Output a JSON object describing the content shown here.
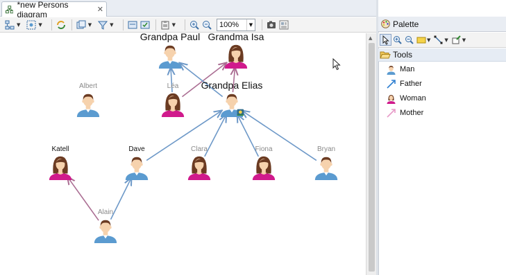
{
  "editor": {
    "tab_title": "*new Persons diagram",
    "zoom": "100%"
  },
  "colors": {
    "man": "#5b9bd0",
    "woman_hair": "#6b3b22",
    "woman_body": "#d01a8c",
    "skin": "#f6d2ad",
    "father_edge": "#6e99c8",
    "mother_edge": "#ab6e93"
  },
  "nodes": [
    {
      "key": "grandpa_paul",
      "name": "Grandpa Paul",
      "gender": "man"
    },
    {
      "key": "grandma_isa",
      "name": "Grandma Isa",
      "gender": "woman"
    },
    {
      "key": "albert",
      "name": "Albert",
      "gender": "man"
    },
    {
      "key": "lea",
      "name": "Léa",
      "gender": "woman"
    },
    {
      "key": "grandpa_elias",
      "name": "Grandpa Elias",
      "gender": "man"
    },
    {
      "key": "katell",
      "name": "Katell",
      "gender": "woman"
    },
    {
      "key": "dave",
      "name": "Dave",
      "gender": "man"
    },
    {
      "key": "clara",
      "name": "Clara",
      "gender": "woman"
    },
    {
      "key": "fiona",
      "name": "Fiona",
      "gender": "woman"
    },
    {
      "key": "bryan",
      "name": "Bryan",
      "gender": "man"
    },
    {
      "key": "alain",
      "name": "Alain",
      "gender": "man"
    }
  ],
  "edges": [
    {
      "from": "lea",
      "to": "grandpa_paul",
      "type": "father"
    },
    {
      "from": "lea",
      "to": "grandma_isa",
      "type": "mother"
    },
    {
      "from": "grandpa_elias",
      "to": "grandpa_paul",
      "type": "father"
    },
    {
      "from": "grandpa_elias",
      "to": "grandma_isa",
      "type": "mother"
    },
    {
      "from": "dave",
      "to": "grandpa_elias",
      "type": "father"
    },
    {
      "from": "clara",
      "to": "grandpa_elias",
      "type": "father"
    },
    {
      "from": "fiona",
      "to": "grandpa_elias",
      "type": "father"
    },
    {
      "from": "bryan",
      "to": "grandpa_elias",
      "type": "father"
    },
    {
      "from": "alain",
      "to": "katell",
      "type": "mother"
    },
    {
      "from": "alain",
      "to": "dave",
      "type": "father"
    }
  ],
  "palette": {
    "title": "Palette",
    "drawer": "Tools",
    "items": [
      {
        "label": "Man",
        "icon": "man-icon"
      },
      {
        "label": "Father",
        "icon": "father-arrow-icon"
      },
      {
        "label": "Woman",
        "icon": "woman-icon"
      },
      {
        "label": "Mother",
        "icon": "mother-arrow-icon"
      }
    ]
  }
}
